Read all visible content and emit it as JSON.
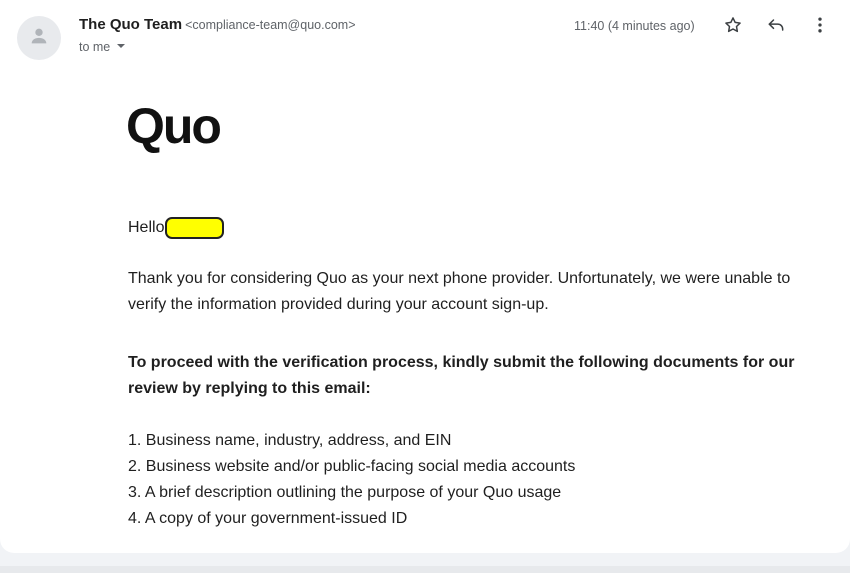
{
  "email": {
    "sender_name": "The Quo Team",
    "sender_email": "<compliance-team@quo.com>",
    "recipient_label": "to me",
    "timestamp": "11:40 (4 minutes ago)",
    "icons": {
      "avatar": "person-icon",
      "star": "star-outline-icon",
      "reply": "reply-icon",
      "more": "more-vert-icon",
      "expand": "caret-down-icon"
    }
  },
  "body": {
    "logo_text": "Quo",
    "greeting": "Hello",
    "intro": "Thank you for considering Quo as your next phone provider. Unfortunately, we were unable to verify the information provided during your account sign-up.",
    "instruction": "To proceed with the verification process, kindly submit the following documents for our review by replying to this email:",
    "requirements": [
      "1. Business name, industry, address, and EIN",
      "2. Business website and/or public-facing social media accounts",
      "3. A brief description outlining the purpose of your Quo usage",
      "4. A copy of your government-issued ID"
    ]
  },
  "colors": {
    "redaction": "#ffff00",
    "text": "#1f1f1f",
    "secondary_text": "#5f6368"
  }
}
